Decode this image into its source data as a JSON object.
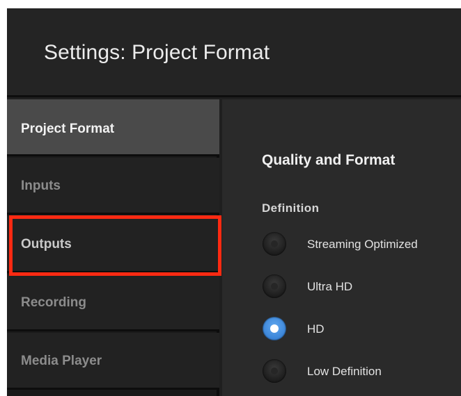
{
  "header": {
    "title": "Settings: Project Format"
  },
  "sidebar": {
    "items": [
      {
        "label": "Project Format",
        "active": true
      },
      {
        "label": "Inputs",
        "active": false
      },
      {
        "label": "Outputs",
        "active": false,
        "highlighted": true
      },
      {
        "label": "Recording",
        "active": false
      },
      {
        "label": "Media Player",
        "active": false
      }
    ]
  },
  "main": {
    "section_title": "Quality and Format",
    "definition": {
      "label": "Definition",
      "options": [
        {
          "label": "Streaming Optimized",
          "selected": false
        },
        {
          "label": "Ultra HD",
          "selected": false
        },
        {
          "label": "HD",
          "selected": true
        },
        {
          "label": "Low Definition",
          "selected": false
        }
      ]
    }
  },
  "colors": {
    "highlight_box": "#ff2a12",
    "radio_selected": "#3c86d9",
    "active_nav": "#4a4a4a"
  }
}
